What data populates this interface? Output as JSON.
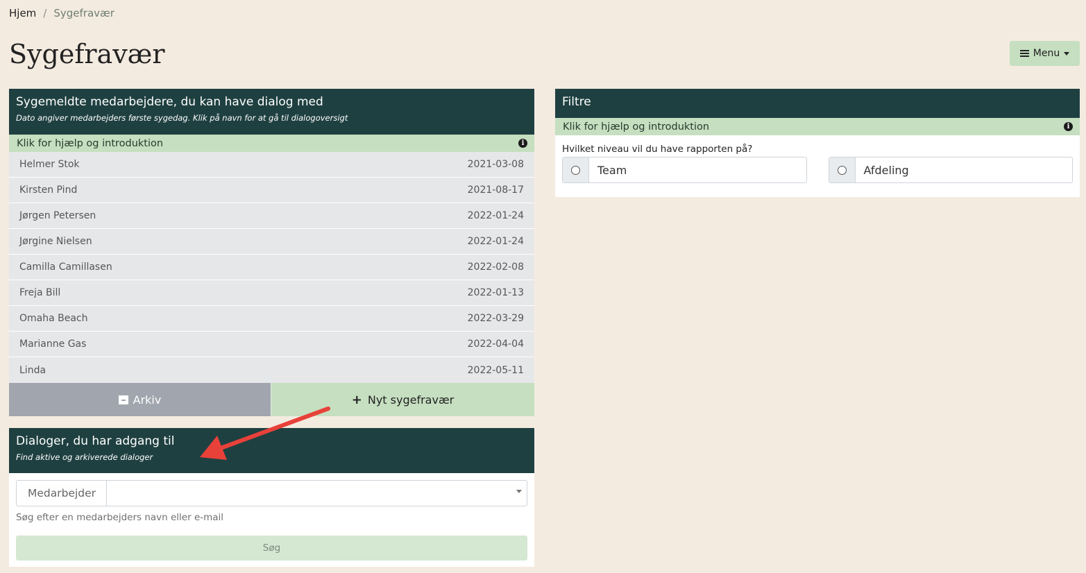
{
  "breadcrumb": {
    "home": "Hjem",
    "separator": "/",
    "current": "Sygefravær"
  },
  "page_title": "Sygefravær",
  "menu": {
    "label": "Menu",
    "icon": "list-icon"
  },
  "sick_panel": {
    "title": "Sygemeldte medarbejdere, du kan have dialog med",
    "subtitle": "Dato angiver medarbejders første sygedag. Klik på navn for at gå til dialogoversigt",
    "help": "Klik for hjælp og introduktion",
    "employees": [
      {
        "name": "Helmer Stok",
        "date": "2021-03-08"
      },
      {
        "name": "Kirsten Pind",
        "date": "2021-08-17"
      },
      {
        "name": "Jørgen Petersen",
        "date": "2022-01-24"
      },
      {
        "name": "Jørgine Nielsen",
        "date": "2022-01-24"
      },
      {
        "name": "Camilla Camillasen",
        "date": "2022-02-08"
      },
      {
        "name": "Freja Bill",
        "date": "2022-01-13"
      },
      {
        "name": "Omaha Beach",
        "date": "2022-03-29"
      },
      {
        "name": "Marianne Gas",
        "date": "2022-04-04"
      },
      {
        "name": "Linda",
        "date": "2022-05-11"
      }
    ],
    "archive_label": "Arkiv",
    "new_label": "Nyt sygefravær"
  },
  "dialog_panel": {
    "title": "Dialoger, du har adgang til",
    "subtitle": "Find aktive og arkiverede dialoger",
    "addon": "Medarbejder",
    "selected": "",
    "hint": "Søg efter en medarbejders navn eller e-mail",
    "search_label": "Søg"
  },
  "filter_panel": {
    "title": "Filtre",
    "help": "Klik for hjælp og introduktion",
    "question": "Hvilket niveau vil du have rapporten på?",
    "options": [
      "Team",
      "Afdeling"
    ]
  },
  "colors": {
    "background": "#f4ebe0",
    "panel_header": "#1f4041",
    "help_bar": "#c5dfc0",
    "archive_button": "#a0a5ae",
    "annotation_arrow": "#e8413a"
  }
}
